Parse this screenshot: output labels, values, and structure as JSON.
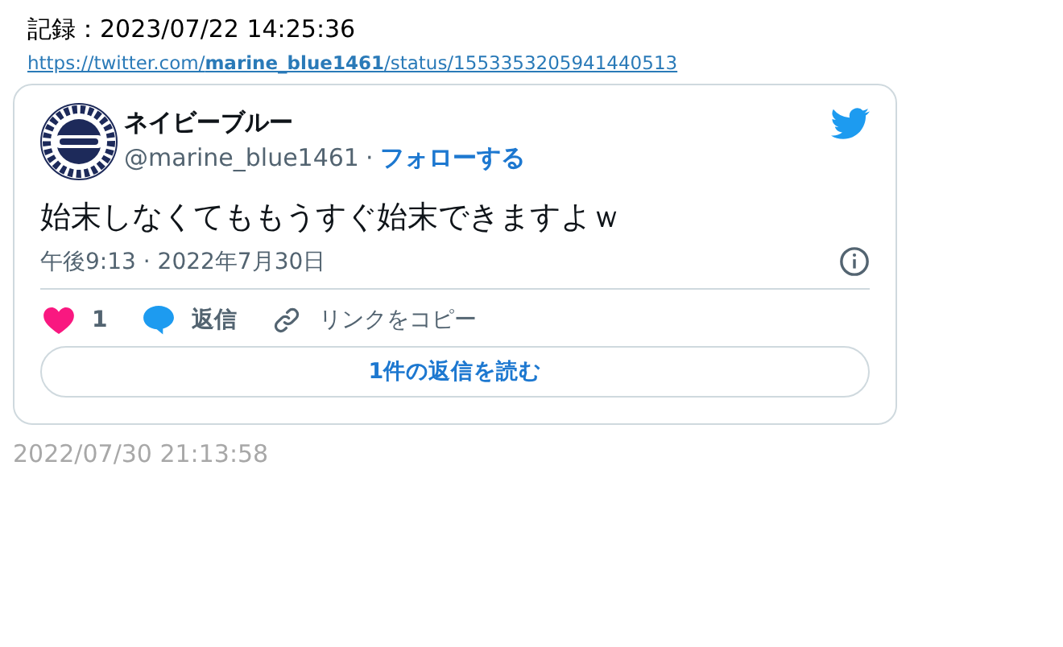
{
  "record": {
    "label": "記録：2023/07/22 14:25:36",
    "url": "https://twitter.com/**marine_blue1461**/status/1553353205941440513"
  },
  "tweet": {
    "author": {
      "name": "ネイビーブルー",
      "handle": "@marine_blue1461",
      "separator": "·",
      "follow": "フォローする"
    },
    "text": "始末しなくてももうすぐ始末できますよｗ",
    "timestamp": "午後9:13 · 2022年7月30日",
    "actions": [
      {
        "kind": "like",
        "label": "1"
      },
      {
        "kind": "reply",
        "label": "返信"
      },
      {
        "kind": "link",
        "label": "リンクをコピー"
      }
    ],
    "read_replies": "1件の返信を読む"
  },
  "footer_date": "2022/07/30 21:13:58"
}
